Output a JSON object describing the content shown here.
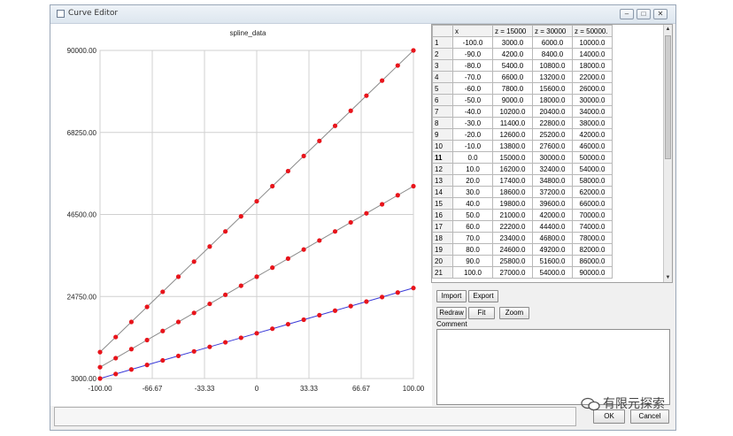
{
  "window": {
    "title": "Curve Editor",
    "minimize_glyph": "–",
    "maximize_glyph": "□",
    "close_glyph": "✕"
  },
  "chart_data": {
    "type": "scatter",
    "title": "spline_data",
    "xlim": [
      -100,
      100
    ],
    "ylim": [
      3000,
      90000
    ],
    "x_ticks": [
      "-100.00",
      "-66.67",
      "-33.33",
      "0",
      "33.33",
      "66.67",
      "100.00"
    ],
    "y_ticks": [
      "3000.00",
      "24750.00",
      "46500.00",
      "68250.00",
      "90000.00"
    ],
    "grid": true,
    "series": [
      {
        "x": [
          -100,
          -90,
          -80,
          -70,
          -60,
          -50,
          -40,
          -30,
          -20,
          -10,
          0,
          10,
          20,
          30,
          40,
          50,
          60,
          70,
          80,
          90,
          100
        ],
        "values": [
          10000,
          14000,
          18000,
          22000,
          26000,
          30000,
          34000,
          38000,
          42000,
          46000,
          50000,
          54000,
          58000,
          62000,
          66000,
          70000,
          74000,
          78000,
          82000,
          86000,
          90000
        ],
        "line_color": "#8a8a8a",
        "marker_color": "#e8141b"
      },
      {
        "x": [
          -100,
          -90,
          -80,
          -70,
          -60,
          -50,
          -40,
          -30,
          -20,
          -10,
          0,
          10,
          20,
          30,
          40,
          50,
          60,
          70,
          80,
          90,
          100
        ],
        "values": [
          6000,
          8400,
          10800,
          13200,
          15600,
          18000,
          20400,
          22800,
          25200,
          27600,
          30000,
          32400,
          34800,
          37200,
          39600,
          42000,
          44400,
          46800,
          49200,
          51600,
          54000
        ],
        "line_color": "#8a8a8a",
        "marker_color": "#e8141b"
      },
      {
        "x": [
          -100,
          -90,
          -80,
          -70,
          -60,
          -50,
          -40,
          -30,
          -20,
          -10,
          0,
          10,
          20,
          30,
          40,
          50,
          60,
          70,
          80,
          90,
          100
        ],
        "values": [
          3000,
          4200,
          5400,
          6600,
          7800,
          9000,
          10200,
          11400,
          12600,
          13800,
          15000,
          16200,
          17400,
          18600,
          19800,
          21000,
          22200,
          23400,
          24600,
          25800,
          27000
        ],
        "line_color": "#3a3ad8",
        "marker_color": "#e8141b"
      }
    ]
  },
  "table": {
    "headers": [
      "",
      "x",
      "z = 15000",
      "z = 30000",
      "z = 50000."
    ],
    "selected_row": "11",
    "rows": [
      [
        "1",
        "-100.0",
        "3000.0",
        "6000.0",
        "10000.0"
      ],
      [
        "2",
        "-90.0",
        "4200.0",
        "8400.0",
        "14000.0"
      ],
      [
        "3",
        "-80.0",
        "5400.0",
        "10800.0",
        "18000.0"
      ],
      [
        "4",
        "-70.0",
        "6600.0",
        "13200.0",
        "22000.0"
      ],
      [
        "5",
        "-60.0",
        "7800.0",
        "15600.0",
        "26000.0"
      ],
      [
        "6",
        "-50.0",
        "9000.0",
        "18000.0",
        "30000.0"
      ],
      [
        "7",
        "-40.0",
        "10200.0",
        "20400.0",
        "34000.0"
      ],
      [
        "8",
        "-30.0",
        "11400.0",
        "22800.0",
        "38000.0"
      ],
      [
        "9",
        "-20.0",
        "12600.0",
        "25200.0",
        "42000.0"
      ],
      [
        "10",
        "-10.0",
        "13800.0",
        "27600.0",
        "46000.0"
      ],
      [
        "11",
        "0.0",
        "15000.0",
        "30000.0",
        "50000.0"
      ],
      [
        "12",
        "10.0",
        "16200.0",
        "32400.0",
        "54000.0"
      ],
      [
        "13",
        "20.0",
        "17400.0",
        "34800.0",
        "58000.0"
      ],
      [
        "14",
        "30.0",
        "18600.0",
        "37200.0",
        "62000.0"
      ],
      [
        "15",
        "40.0",
        "19800.0",
        "39600.0",
        "66000.0"
      ],
      [
        "16",
        "50.0",
        "21000.0",
        "42000.0",
        "70000.0"
      ],
      [
        "17",
        "60.0",
        "22200.0",
        "44400.0",
        "74000.0"
      ],
      [
        "18",
        "70.0",
        "23400.0",
        "46800.0",
        "78000.0"
      ],
      [
        "19",
        "80.0",
        "24600.0",
        "49200.0",
        "82000.0"
      ],
      [
        "20",
        "90.0",
        "25800.0",
        "51600.0",
        "86000.0"
      ],
      [
        "21",
        "100.0",
        "27000.0",
        "54000.0",
        "90000.0"
      ]
    ]
  },
  "buttons": {
    "import": "Import",
    "export": "Export",
    "redraw": "Redraw",
    "fit": "Fit",
    "zoom": "Zoom",
    "ok": "OK",
    "cancel": "Cancel"
  },
  "comment_label": "Comment",
  "watermark": "有限元探索"
}
